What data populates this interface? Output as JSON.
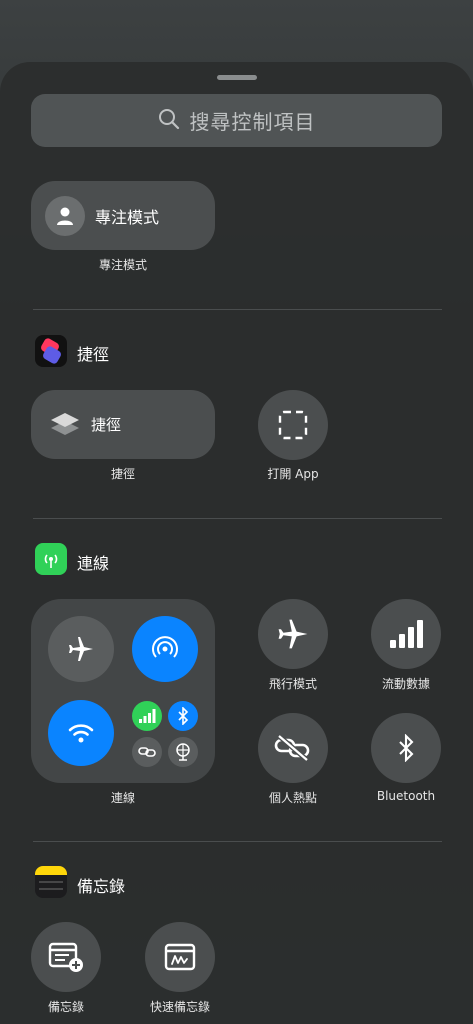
{
  "search": {
    "placeholder": "搜尋控制項目",
    "icon": "search-icon"
  },
  "focus": {
    "tile_label": "專注模式",
    "caption": "專注模式",
    "icon": "person-icon"
  },
  "shortcuts": {
    "section_title": "捷徑",
    "tile_label": "捷徑",
    "tile_caption": "捷徑",
    "open_app_caption": "打開 App"
  },
  "connectivity": {
    "section_title": "連線",
    "group_caption": "連線",
    "airplane_caption": "飛行模式",
    "cellular_caption": "流動數據",
    "hotspot_caption": "個人熱點",
    "bluetooth_caption": "Bluetooth"
  },
  "notes": {
    "section_title": "備忘錄",
    "new_note_caption": "備忘錄",
    "quick_note_caption": "快速備忘錄"
  },
  "colors": {
    "active_blue": "#0a84ff",
    "active_green": "#30d158",
    "tile_gray": "#4b4e4f"
  }
}
